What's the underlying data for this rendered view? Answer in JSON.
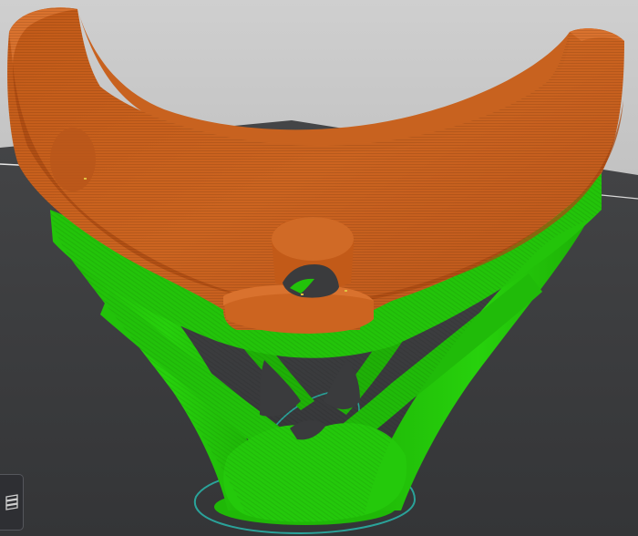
{
  "scene": {
    "background_top": "#cfcfcf",
    "background_bottom": "#a8a8a8",
    "bed_color": "#3a3b3d",
    "model_color": "#c7601c",
    "model_shadow_color": "#9c4410",
    "model_highlight_color": "#e07a38",
    "support_color": "#22cc08",
    "support_shadow_color": "#17990a",
    "skirt_color": "#2aa39a"
  },
  "controls": {
    "layers_icon": "layers-icon"
  }
}
